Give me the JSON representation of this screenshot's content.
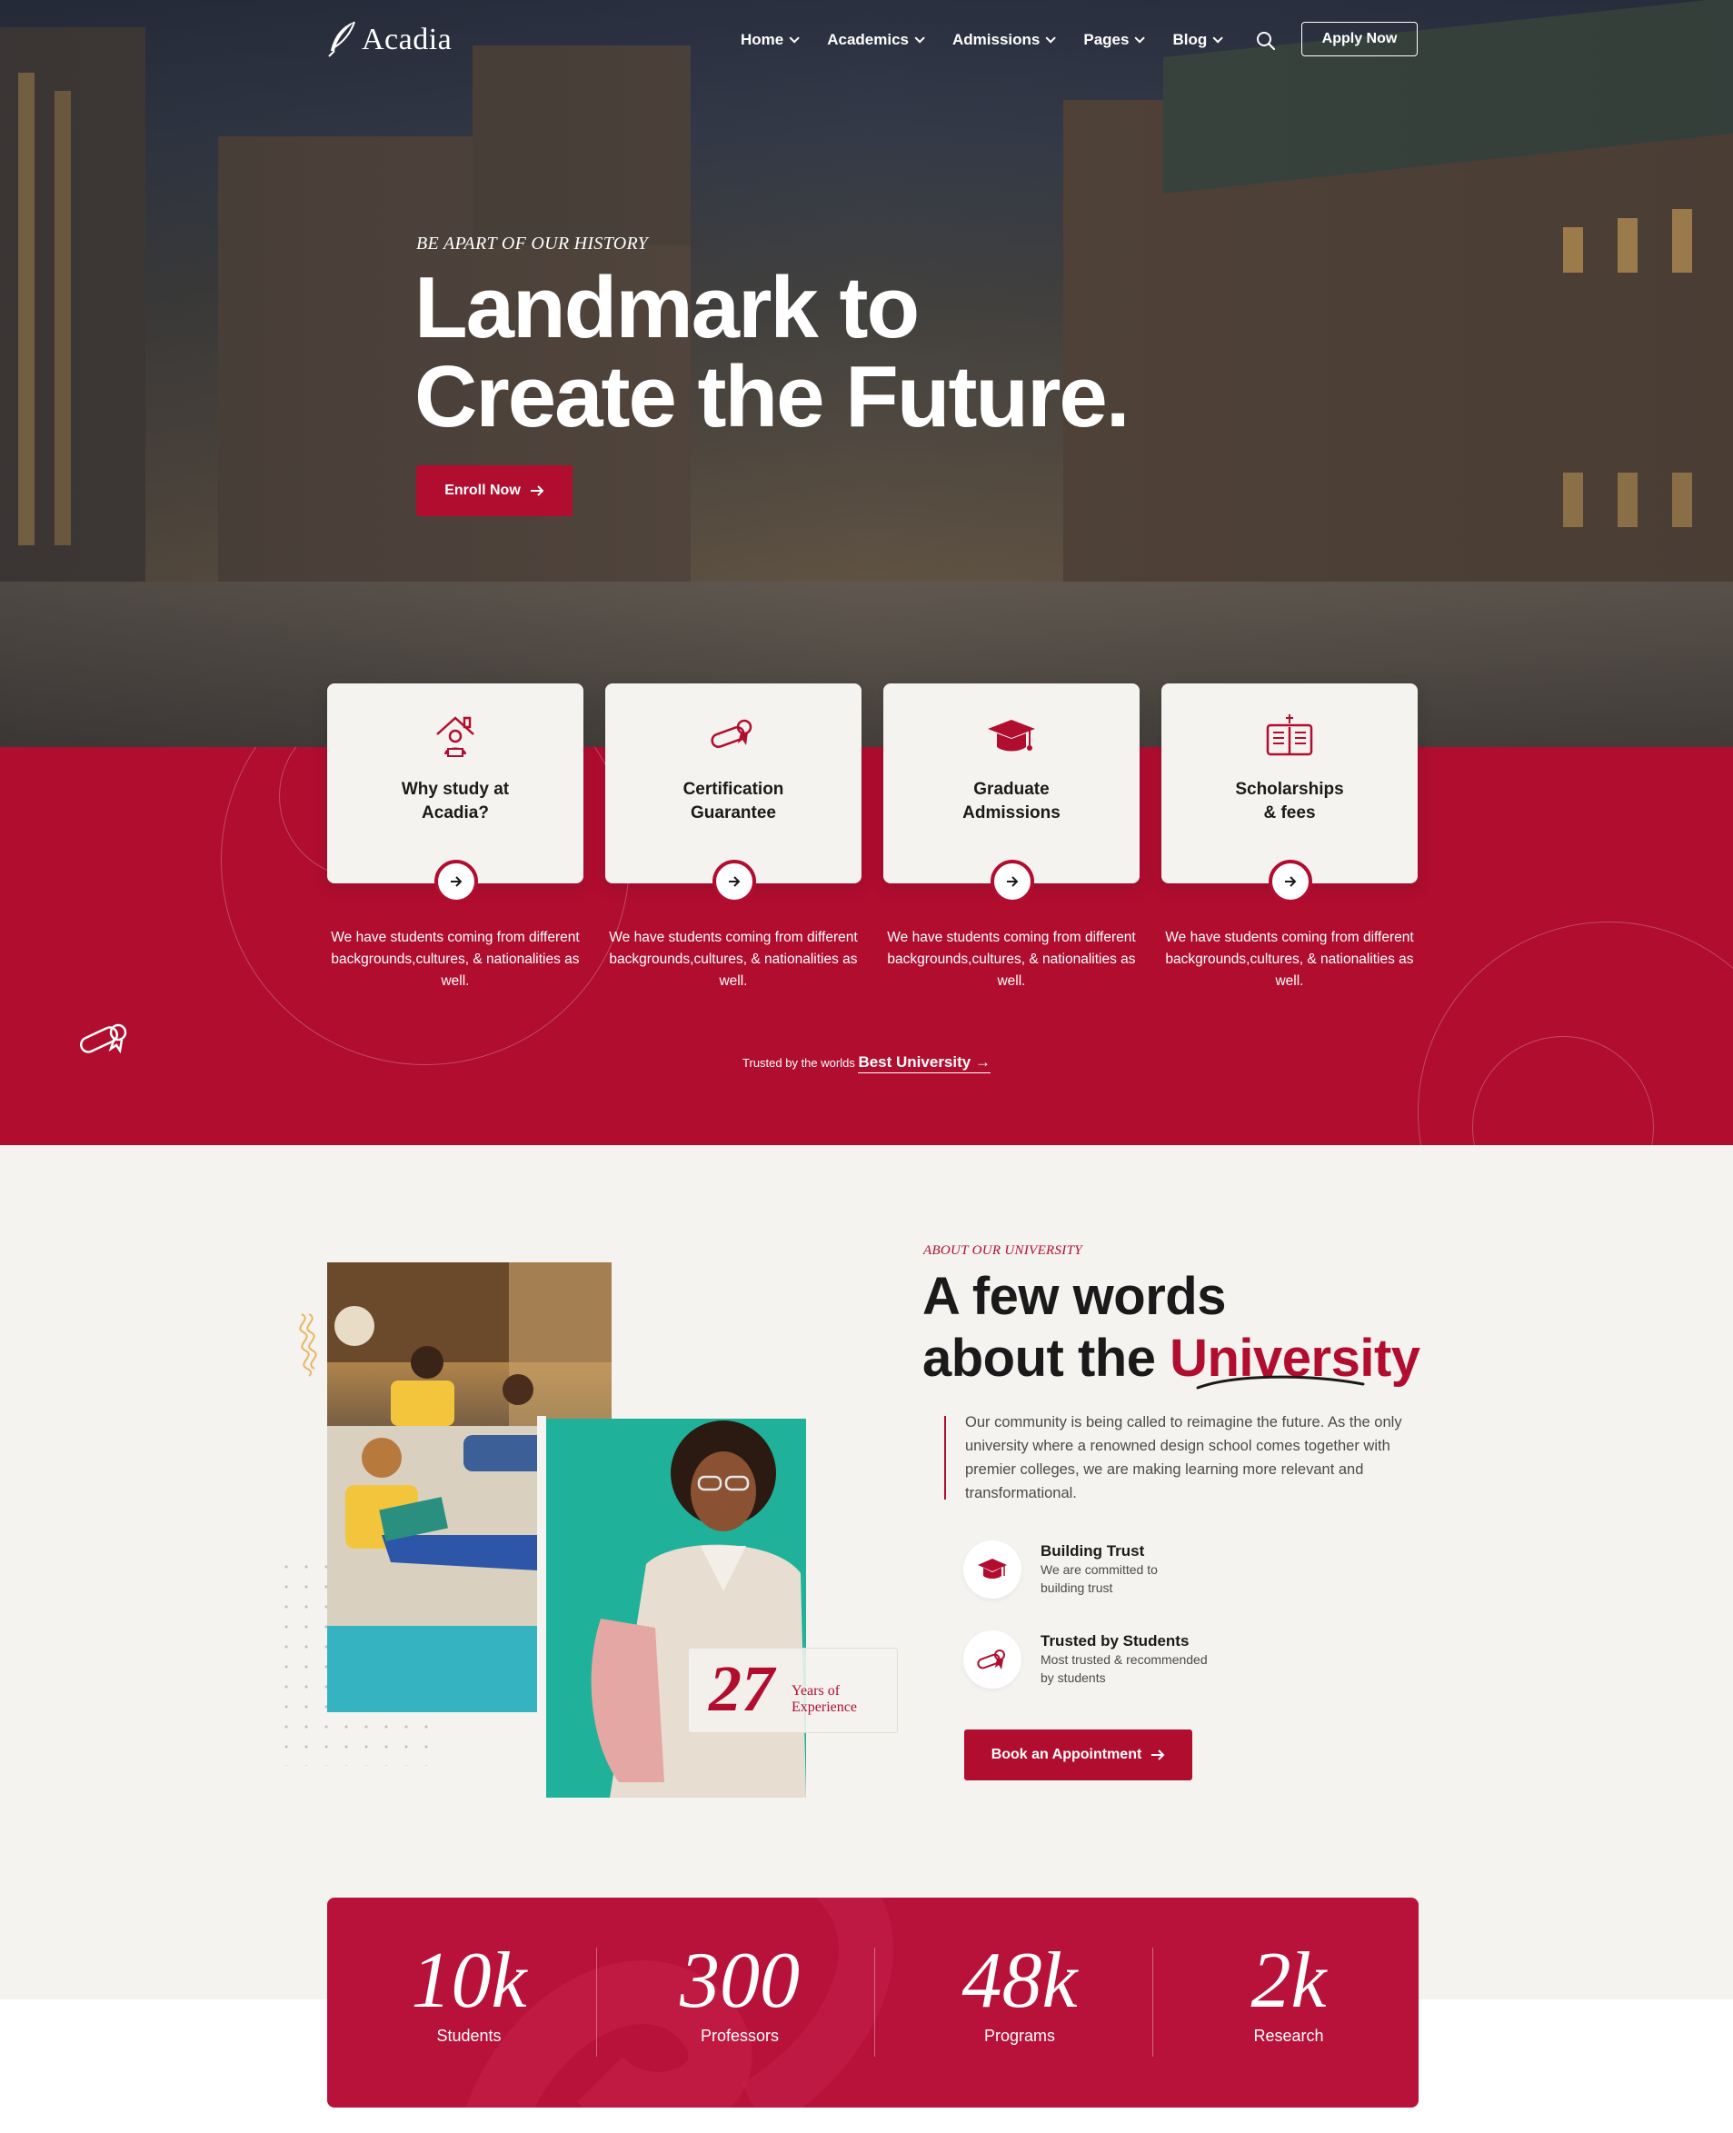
{
  "brand": {
    "name": "Acadia"
  },
  "nav": {
    "items": [
      {
        "label": "Home"
      },
      {
        "label": "Academics"
      },
      {
        "label": "Admissions"
      },
      {
        "label": "Pages"
      },
      {
        "label": "Blog"
      }
    ],
    "apply_label": "Apply Now"
  },
  "hero": {
    "kicker": "BE APART OF OUR HISTORY",
    "title_line1": "Landmark to",
    "title_line2": "Create the Future.",
    "cta_label": "Enroll Now"
  },
  "cards": [
    {
      "title_line1": "Why study at",
      "title_line2": "Acadia?",
      "icon": "student-house-icon",
      "desc": "We have students coming from different backgrounds,cultures, & nationalities as well."
    },
    {
      "title_line1": "Certification",
      "title_line2": "Guarantee",
      "icon": "diploma-icon",
      "desc": "We have students coming from different backgrounds,cultures, & nationalities as well."
    },
    {
      "title_line1": "Graduate",
      "title_line2": "Admissions",
      "icon": "graduation-cap-icon",
      "desc": "We have students coming from different backgrounds,cultures, & nationalities as well."
    },
    {
      "title_line1": "Scholarships",
      "title_line2": "& fees",
      "icon": "open-book-icon",
      "desc": "We have students coming from different backgrounds,cultures, & nationalities as well."
    }
  ],
  "trusted": {
    "prefix": "Trusted by the worlds",
    "link": "Best University"
  },
  "about": {
    "kicker": "ABOUT OUR UNIVERSITY",
    "title_line1": "A few words",
    "title_line2_plain": "about the",
    "title_line2_accent": "University",
    "paragraph": "Our community is being called to reimagine the future. As the only university where a renowned design school comes together with premier colleges, we are making learning more relevant and transformational.",
    "experience": {
      "number": "27",
      "line1": "Years of",
      "line2": "Experience"
    },
    "features": [
      {
        "title": "Building Trust",
        "desc_line1": "We are committed to",
        "desc_line2": "building trust",
        "icon": "graduation-cap-icon"
      },
      {
        "title": "Trusted by Students",
        "desc_line1": "Most trusted & recommended",
        "desc_line2": "by students",
        "icon": "diploma-icon"
      }
    ],
    "cta_label": "Book an Appointment"
  },
  "stats": [
    {
      "number": "10k",
      "label": "Students"
    },
    {
      "number": "300",
      "label": "Professors"
    },
    {
      "number": "48k",
      "label": "Programs"
    },
    {
      "number": "2k",
      "label": "Research"
    }
  ],
  "colors": {
    "accent": "#b10d2f",
    "background": "#f5f3ef",
    "stats_bg": "#b8123a"
  }
}
